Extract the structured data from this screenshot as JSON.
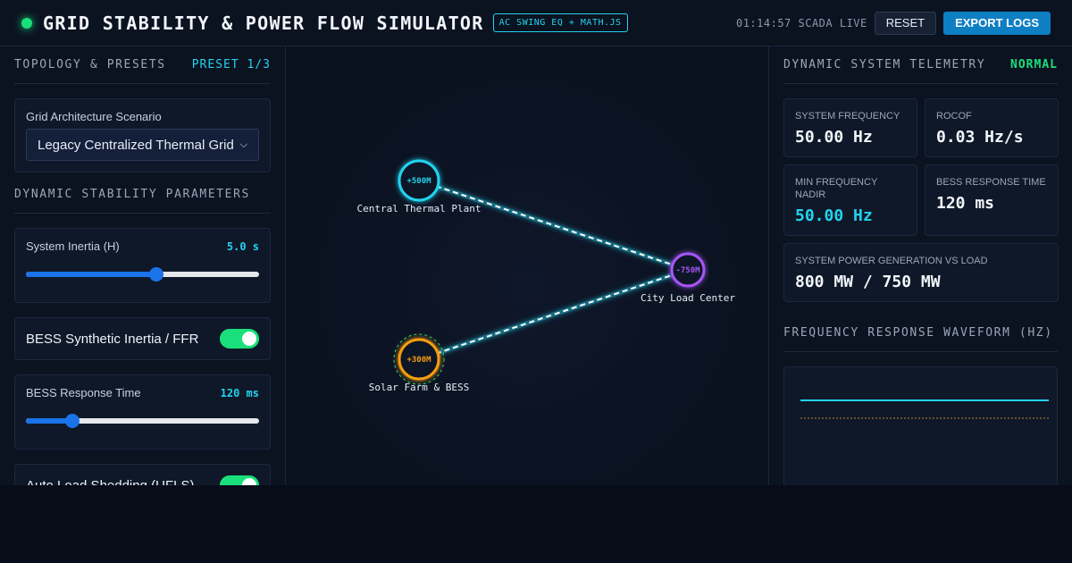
{
  "header": {
    "title": "GRID STABILITY & POWER FLOW SIMULATOR",
    "engine_badge": "AC SWING EQ + MATH.JS",
    "clock": "01:14:57 SCADA LIVE",
    "reset_label": "RESET",
    "export_label": "EXPORT LOGS"
  },
  "left": {
    "topology_title": "TOPOLOGY & PRESETS",
    "preset_indicator": "PRESET 1/3",
    "scenario_label": "Grid Architecture Scenario",
    "scenario_value": "Legacy Centralized Thermal Grid",
    "params_title": "DYNAMIC STABILITY PARAMETERS",
    "inertia_label": "System Inertia (H)",
    "inertia_value": "5.0 s",
    "inertia_fraction": 0.56,
    "bess_label": "BESS Synthetic Inertia / FFR",
    "bess_enabled": true,
    "response_label": "BESS Response Time",
    "response_value": "120 ms",
    "response_fraction": 0.2,
    "ufls_label": "Auto Load Shedding (UFLS)",
    "ufls_enabled": true
  },
  "network": {
    "nodes": [
      {
        "id": "thermal",
        "value": "+500M",
        "label": "Central Thermal Plant",
        "color": "#22d3ee"
      },
      {
        "id": "load",
        "value": "-750M",
        "label": "City Load Center",
        "color": "#a855f7"
      },
      {
        "id": "solar",
        "value": "+300M",
        "label": "Solar Farm & BESS",
        "color": "#f59e0b"
      }
    ]
  },
  "right": {
    "telemetry_title": "DYNAMIC SYSTEM TELEMETRY",
    "status": "NORMAL",
    "freq_label": "SYSTEM FREQUENCY",
    "freq_value": "50.00 Hz",
    "rocof_label": "ROCOF",
    "rocof_value": "0.03 Hz/s",
    "nadir_label": "MIN FREQUENCY NADIR",
    "nadir_value": "50.00 Hz",
    "bess_time_label": "BESS RESPONSE TIME",
    "bess_time_value": "120 ms",
    "gen_label": "SYSTEM POWER GENERATION VS LOAD",
    "gen_value": "800 MW / 750 MW",
    "waveform_title": "FREQUENCY RESPONSE WAVEFORM (HZ)"
  },
  "colors": {
    "accent_cyan": "#22d3ee",
    "ok_green": "#19e07a",
    "load_purple": "#a855f7",
    "solar_amber": "#f59e0b"
  }
}
